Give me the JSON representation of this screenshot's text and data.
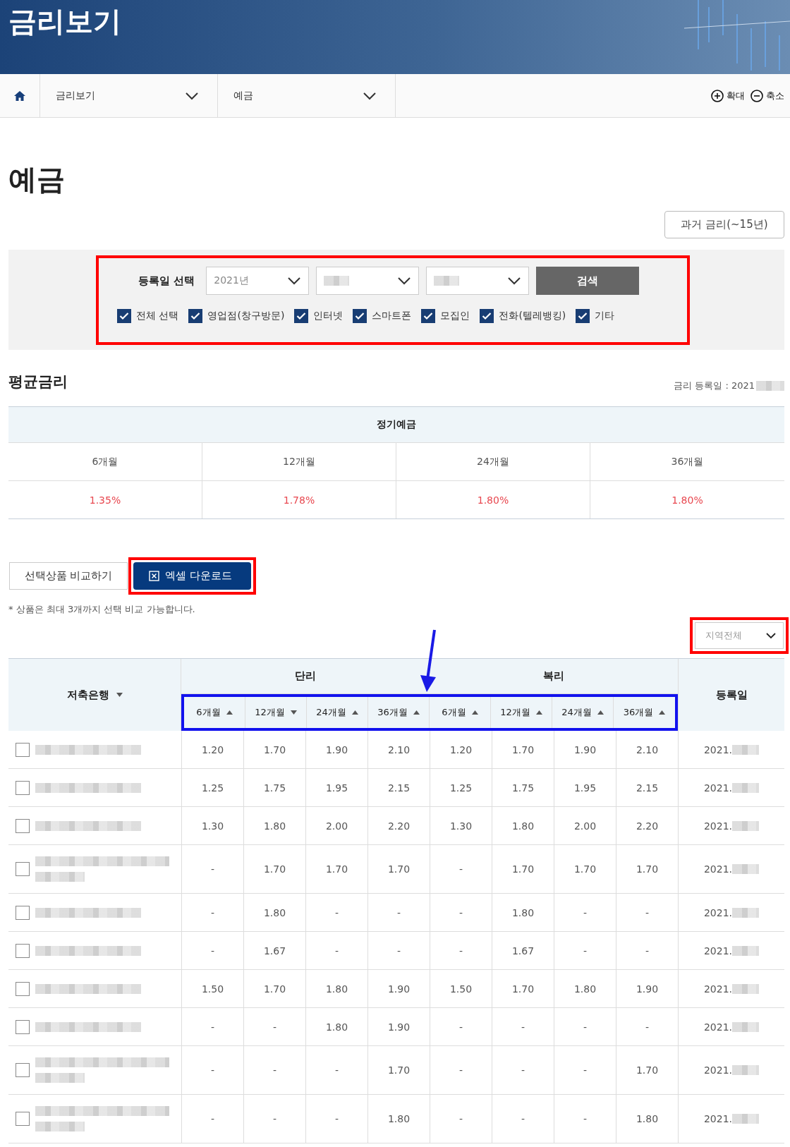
{
  "header": {
    "title": "금리보기"
  },
  "breadcrumb": [
    {
      "label": "금리보기"
    },
    {
      "label": "예금"
    }
  ],
  "zoom_controls": [
    {
      "kind": "zoom-in",
      "label": "확대"
    },
    {
      "kind": "zoom-out",
      "label": "축소"
    }
  ],
  "page_title": "예금",
  "history_button": "과거 금리(~15년)",
  "filter": {
    "annotated": true,
    "label": "등록일 선택",
    "search_button": "검색",
    "selects": [
      {
        "kind": "value",
        "value": "2021년"
      },
      {
        "kind": "redacted"
      },
      {
        "kind": "redacted"
      }
    ],
    "channels": [
      {
        "label": "전체 선택",
        "checked": true
      },
      {
        "label": "영업점(창구방문)",
        "checked": true
      },
      {
        "label": "인터넷",
        "checked": true
      },
      {
        "label": "스마트폰",
        "checked": true
      },
      {
        "label": "모집인",
        "checked": true
      },
      {
        "label": "전화(텔레뱅킹)",
        "checked": true
      },
      {
        "label": "기타",
        "checked": true
      }
    ]
  },
  "average": {
    "title": "평균금리",
    "date_label": "금리 등록일 : 2021",
    "product": "정기예금",
    "terms": [
      {
        "term": "6개월",
        "rate": "1.35%"
      },
      {
        "term": "12개월",
        "rate": "1.78%"
      },
      {
        "term": "24개월",
        "rate": "1.80%"
      },
      {
        "term": "36개월",
        "rate": "1.80%"
      }
    ]
  },
  "actions": [
    {
      "kind": "outline",
      "label": "선택상품 비교하기",
      "annotated": false
    },
    {
      "kind": "primary",
      "label": "엑셀 다운로드",
      "annotated": true
    }
  ],
  "note": "* 상품은 최대 3개까지 선택 비교 가능합니다.",
  "region_select": {
    "value": "지역전체",
    "annotated": true
  },
  "table": {
    "bank_column": {
      "label": "저축은행",
      "descending": true
    },
    "groups": [
      "단리",
      "복리"
    ],
    "terms_annotated": true,
    "terms": [
      {
        "label": "6개월",
        "descending": false
      },
      {
        "label": "12개월",
        "descending": true
      },
      {
        "label": "24개월",
        "descending": false
      },
      {
        "label": "36개월",
        "descending": false
      },
      {
        "label": "6개월",
        "descending": false
      },
      {
        "label": "12개월",
        "descending": false
      },
      {
        "label": "24개월",
        "descending": false
      },
      {
        "label": "36개월",
        "descending": false
      }
    ],
    "date_column": "등록일",
    "rows": [
      {
        "kind": "short",
        "checked": false,
        "rates": [
          "1.20",
          "1.70",
          "1.90",
          "2.10",
          "1.20",
          "1.70",
          "1.90",
          "2.10"
        ],
        "date": "2021."
      },
      {
        "kind": "short",
        "checked": false,
        "rates": [
          "1.25",
          "1.75",
          "1.95",
          "2.15",
          "1.25",
          "1.75",
          "1.95",
          "2.15"
        ],
        "date": "2021."
      },
      {
        "kind": "short",
        "checked": false,
        "rates": [
          "1.30",
          "1.80",
          "2.00",
          "2.20",
          "1.30",
          "1.80",
          "2.00",
          "2.20"
        ],
        "date": "2021."
      },
      {
        "kind": "tall",
        "checked": false,
        "rates": [
          "-",
          "1.70",
          "1.70",
          "1.70",
          "-",
          "1.70",
          "1.70",
          "1.70"
        ],
        "date": "2021."
      },
      {
        "kind": "short",
        "checked": false,
        "rates": [
          "-",
          "1.80",
          "-",
          "-",
          "-",
          "1.80",
          "-",
          "-"
        ],
        "date": "2021."
      },
      {
        "kind": "short",
        "checked": false,
        "rates": [
          "-",
          "1.67",
          "-",
          "-",
          "-",
          "1.67",
          "-",
          "-"
        ],
        "date": "2021."
      },
      {
        "kind": "short",
        "checked": false,
        "rates": [
          "1.50",
          "1.70",
          "1.80",
          "1.90",
          "1.50",
          "1.70",
          "1.80",
          "1.90"
        ],
        "date": "2021."
      },
      {
        "kind": "short",
        "checked": false,
        "rates": [
          "-",
          "-",
          "1.80",
          "1.90",
          "-",
          "-",
          "-",
          "-"
        ],
        "date": "2021."
      },
      {
        "kind": "tall",
        "checked": false,
        "rates": [
          "-",
          "-",
          "-",
          "1.70",
          "-",
          "-",
          "-",
          "1.70"
        ],
        "date": "2021."
      },
      {
        "kind": "tall",
        "checked": false,
        "rates": [
          "-",
          "-",
          "-",
          "1.80",
          "-",
          "-",
          "-",
          "1.80"
        ],
        "date": "2021."
      }
    ]
  }
}
